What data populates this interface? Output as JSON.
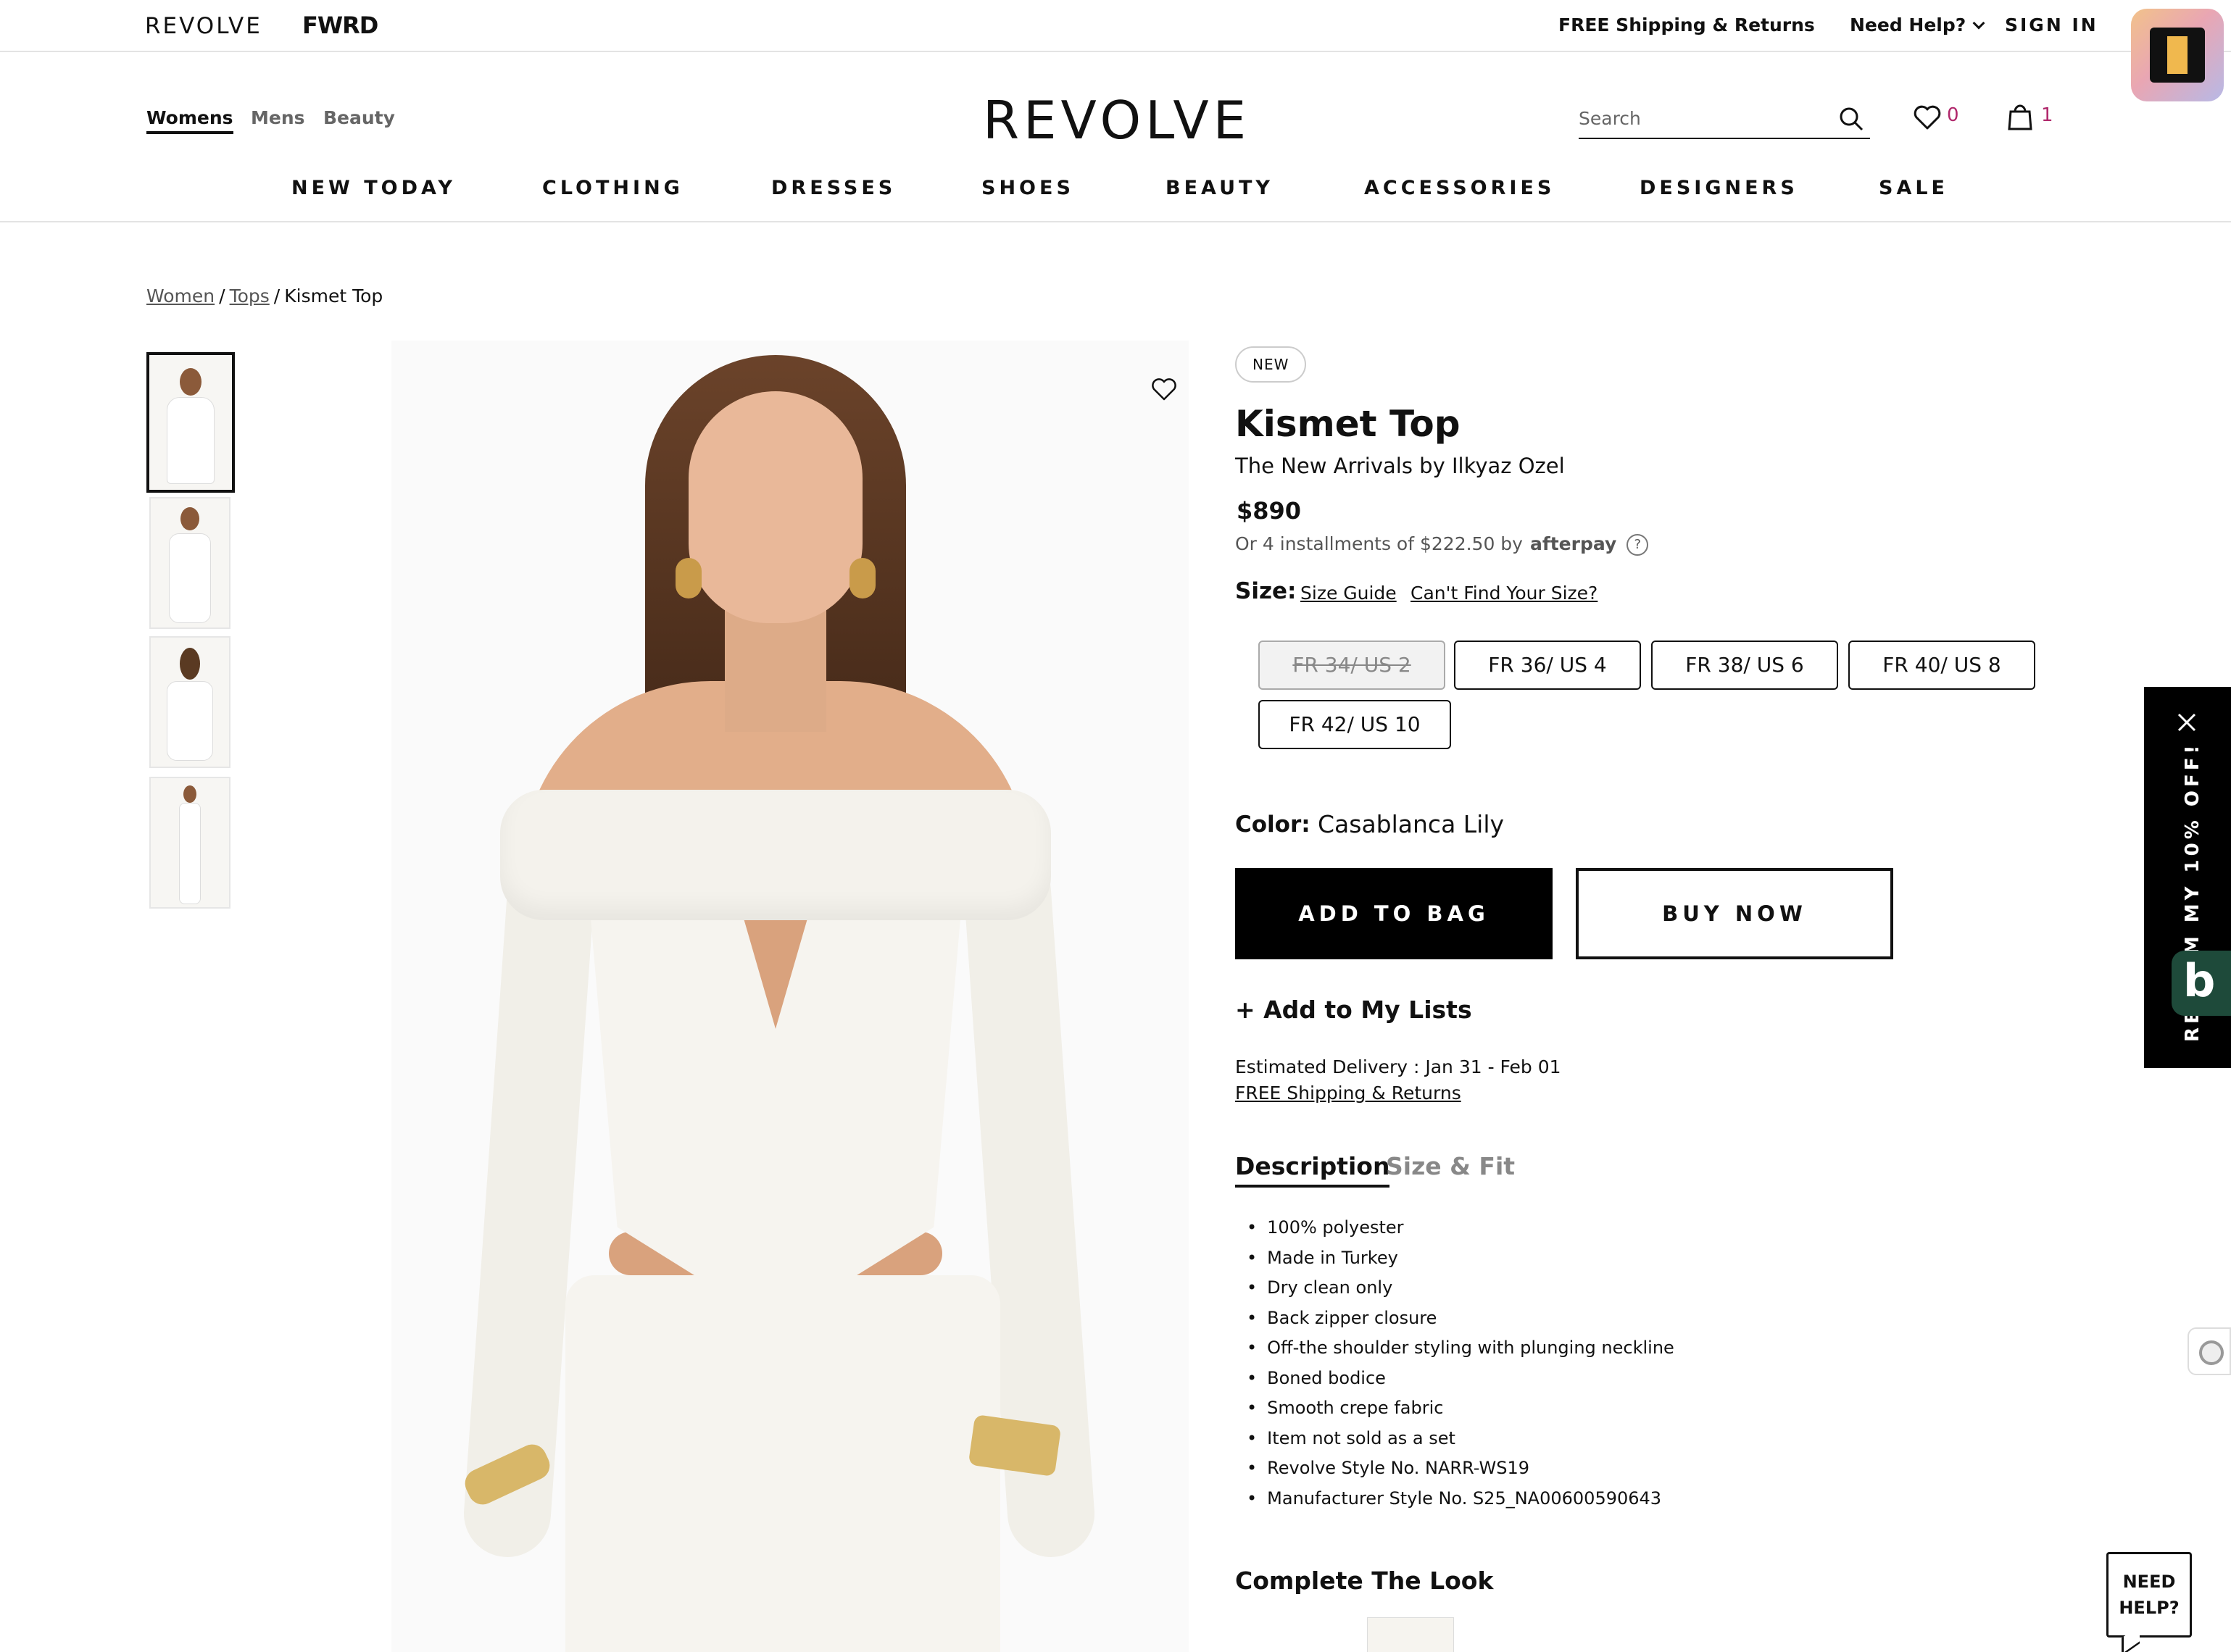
{
  "topbar": {
    "brand_revolve": "REVOLVE",
    "brand_fwrd": "FWRD",
    "free_shipping": "FREE Shipping & Returns",
    "need_help": "Need Help?",
    "sign_in": "SIGN IN"
  },
  "header": {
    "gender_nav": [
      "Womens",
      "Mens",
      "Beauty"
    ],
    "logo": "REVOLVE",
    "search_placeholder": "Search",
    "wishlist_count": "0",
    "bag_count": "1",
    "categories": [
      "NEW TODAY",
      "CLOTHING",
      "DRESSES",
      "SHOES",
      "BEAUTY",
      "ACCESSORIES",
      "DESIGNERS",
      "SALE"
    ]
  },
  "breadcrumb": {
    "items": [
      "Women",
      "Tops"
    ],
    "separator": "/",
    "current": "Kismet Top"
  },
  "gallery": {
    "thumbnail_count": 4,
    "selected_index": 0
  },
  "product": {
    "badge": "NEW",
    "title": "Kismet Top",
    "brand": "The New Arrivals by Ilkyaz Ozel",
    "price": "$890",
    "afterpay_text": "Or 4 installments of $222.50 by",
    "afterpay_logo": "afterpay",
    "help_icon_text": "?",
    "size_label": "Size:",
    "size_guide": "Size Guide",
    "cant_find_size": "Can't Find Your Size?",
    "sizes": [
      {
        "label": "FR 34/ US 2",
        "available": false
      },
      {
        "label": "FR 36/ US 4",
        "available": true
      },
      {
        "label": "FR 38/ US 6",
        "available": true
      },
      {
        "label": "FR 40/ US 8",
        "available": true
      },
      {
        "label": "FR 42/ US 10",
        "available": true
      }
    ],
    "color_label": "Color:",
    "color_value": "Casablanca Lily",
    "add_to_bag": "ADD TO BAG",
    "buy_now": "BUY NOW",
    "add_to_lists": "+ Add to My Lists",
    "estimated_delivery": "Estimated Delivery : Jan 31 - Feb 01",
    "free_shipping_link": "FREE Shipping & Returns",
    "tabs": [
      "Description",
      "Size & Fit"
    ],
    "active_tab": "Description",
    "description": [
      "100% polyester",
      "Made in Turkey",
      "Dry clean only",
      "Back zipper closure",
      "Off-the shoulder styling with plunging neckline",
      "Boned bodice",
      "Smooth crepe fabric",
      "Item not sold as a set",
      "Revolve Style No. NARR-WS19",
      "Manufacturer Style No. S25_NA00600590643"
    ],
    "complete_the_look": "Complete The Look"
  },
  "widgets": {
    "promo_text": "REDEEM MY 10% OFF!",
    "b_widget": "b",
    "need_help_line1": "NEED",
    "need_help_line2": "HELP?"
  },
  "colors": {
    "count_accent": "#b0276b",
    "primary_button": "#000000",
    "b_widget_bg": "#1e4a3a"
  }
}
